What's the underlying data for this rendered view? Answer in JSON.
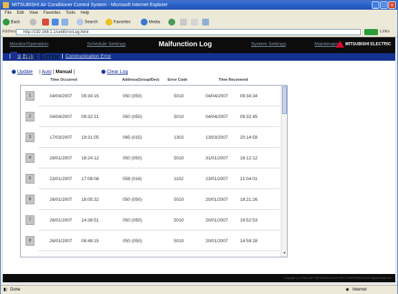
{
  "window": {
    "title": "MITSUBISHI Air Conditioner Control System - Microsoft Internet Explorer",
    "menu": [
      "File",
      "Edit",
      "View",
      "Favorites",
      "Tools",
      "Help"
    ],
    "toolbar": {
      "back": "Back",
      "search": "Search",
      "favorites": "Favorites",
      "media": "Media"
    },
    "address_label": "Address",
    "address": "http://192.168.1.1/unitErrorLog.html",
    "links_label": "Links"
  },
  "nav": {
    "items": [
      "Monitor/Operation",
      "Schedule Settings",
      "Malfunction Log",
      "System Settings",
      "Maintenance"
    ],
    "active_index": 2,
    "logo_text": "MITSUBISHI ELECTRIC"
  },
  "subnav": {
    "items": [
      "Unit Error",
      "Communication Error"
    ]
  },
  "page_title": "Unit Error",
  "controls": {
    "update": "Update",
    "auto": "Auto",
    "manual": "Manual",
    "clear_log": "Clear Log"
  },
  "columns": {
    "time_occurred": "Time Occurred",
    "address": "Address(Group/Dev)",
    "error_code": "Error Code",
    "time_recovered": "Time Recovered"
  },
  "rows": [
    {
      "num": "1",
      "date": "04/04/2007",
      "time": "09:34:15",
      "address": "050 (050)",
      "code": "5010",
      "rec_date": "04/04/2007",
      "rec_time": "09:34:34"
    },
    {
      "num": "2",
      "date": "04/04/2007",
      "time": "09:32:21",
      "address": "050 (050)",
      "code": "5010",
      "rec_date": "04/04/2007",
      "rec_time": "09:32:45"
    },
    {
      "num": "3",
      "date": "17/03/2007",
      "time": "19:31:05",
      "address": "065 (015)",
      "code": "1302",
      "rec_date": "13/03/2007",
      "rec_time": "20:14:59"
    },
    {
      "num": "4",
      "date": "29/01/2007",
      "time": "18:24:12",
      "address": "050 (050)",
      "code": "5010",
      "rec_date": "31/01/2007",
      "rec_time": "18:12:12"
    },
    {
      "num": "5",
      "date": "23/01/2007",
      "time": "17:08:08",
      "address": "058 (016)",
      "code": "1102",
      "rec_date": "23/01/2007",
      "rec_time": "21:04:01"
    },
    {
      "num": "6",
      "date": "26/01/2007",
      "time": "18:05:32",
      "address": "050 (050)",
      "code": "5010",
      "rec_date": "20/01/2007",
      "rec_time": "18:21:26"
    },
    {
      "num": "7",
      "date": "26/01/2007",
      "time": "14:38:51",
      "address": "050 (050)",
      "code": "5010",
      "rec_date": "20/01/2007",
      "rec_time": "19:52:53"
    },
    {
      "num": "8",
      "date": "26/01/2007",
      "time": "08:48:15",
      "address": "050 (050)",
      "code": "5010",
      "rec_date": "20/01/2007",
      "rec_time": "14:59:28"
    }
  ],
  "footer": "Copyright (C) 2003-2007 MITSUBISHI ELECTRIC CORPORATION All Rights Reserved",
  "status": {
    "left": "Done",
    "zone": "Internet"
  }
}
